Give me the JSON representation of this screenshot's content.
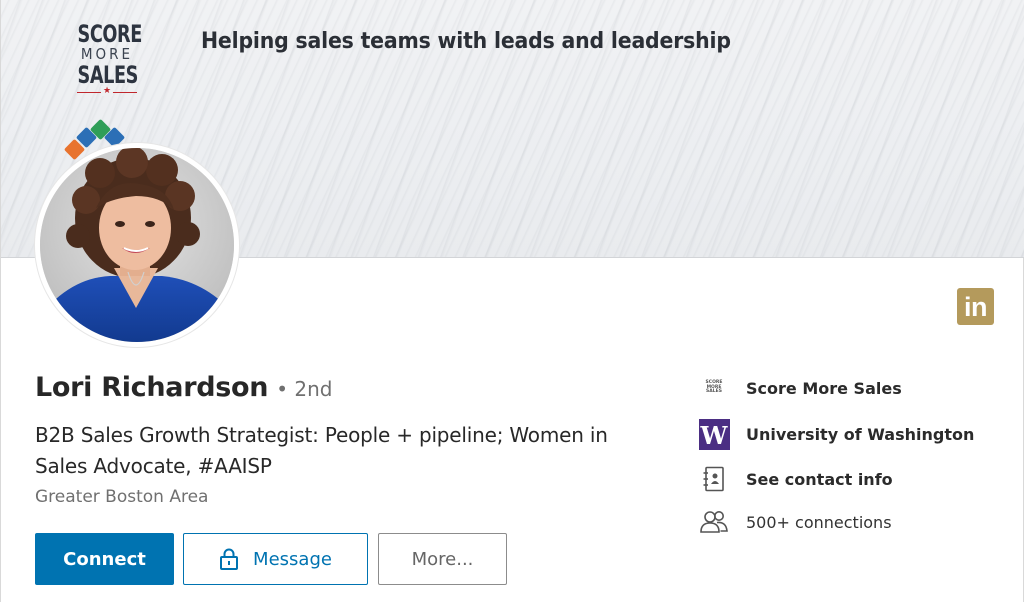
{
  "banner": {
    "logo": {
      "line1": "SCORE",
      "line2": "MORE",
      "line3": "SALES",
      "star": "★"
    },
    "tagline": "Helping sales teams with leads and leadership"
  },
  "profile": {
    "name": "Lori Richardson",
    "degree": "• 2nd",
    "headline": "B2B Sales Growth Strategist: People + pipeline; Women in Sales Advocate, #AAISP",
    "location": "Greater Boston Area"
  },
  "actions": {
    "connect": "Connect",
    "message": "Message",
    "more": "More..."
  },
  "sidebar": {
    "company": "Score More Sales",
    "company_icon_text": [
      "SCORE",
      "MORE",
      "SALES"
    ],
    "school": "University of Washington",
    "school_icon_text": "W",
    "contact": "See contact info",
    "connections": "500+ connections"
  },
  "badge": {
    "text": "in"
  },
  "colors": {
    "primary": "#0073b1",
    "badge": "#b49a5c",
    "uw_purple": "#4b2e83",
    "logo_red": "#c0272d"
  },
  "icons": {
    "message": "lock-icon",
    "contact": "contact-card-icon",
    "connections": "people-icon"
  }
}
